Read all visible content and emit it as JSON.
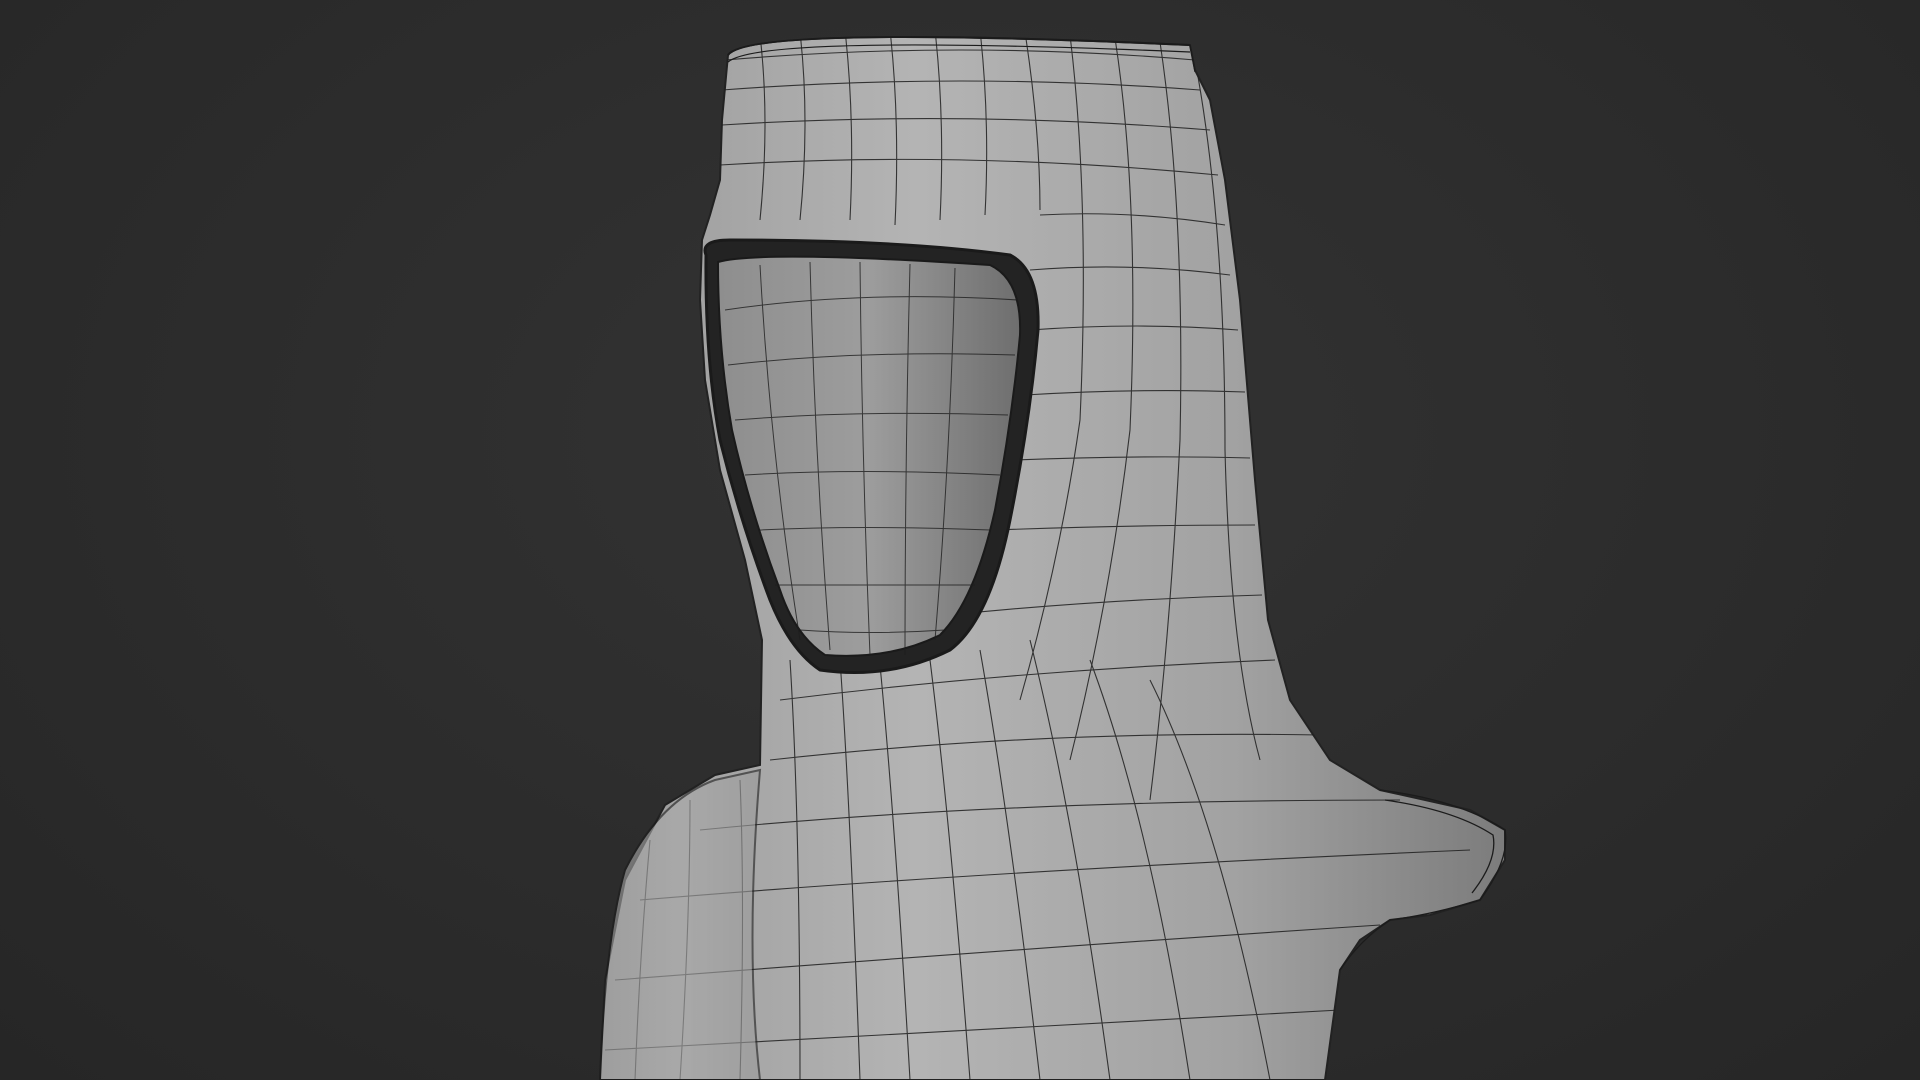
{
  "viewport": {
    "background": "#2b2b2b",
    "shading": "solid-gray",
    "overlay": "wireframe"
  },
  "model": {
    "object": "hood-mesh",
    "surface_color": "#a7a7a7",
    "wire_color": "#1a1a1a"
  }
}
